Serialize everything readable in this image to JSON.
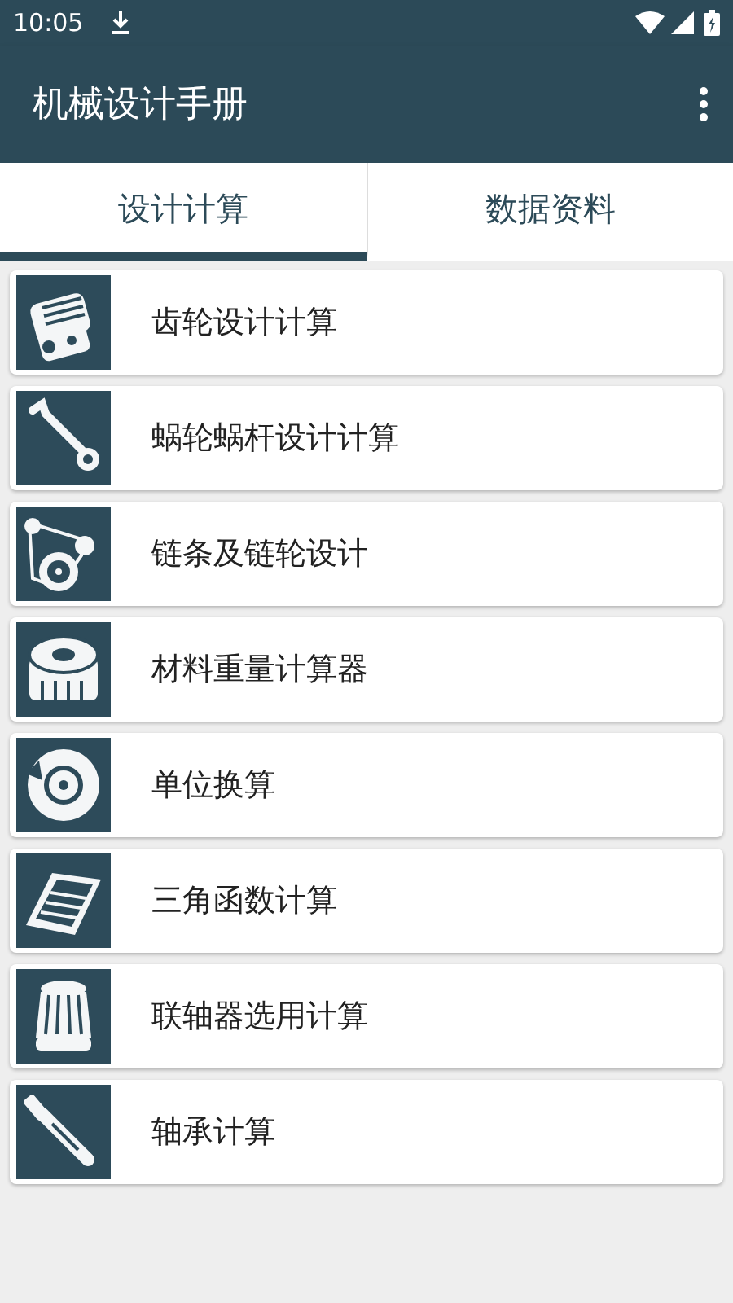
{
  "status_bar": {
    "time": "10:05"
  },
  "app_bar": {
    "title": "机械设计手册"
  },
  "tabs": [
    {
      "label": "设计计算",
      "selected": true
    },
    {
      "label": "数据资料",
      "selected": false
    }
  ],
  "items": [
    {
      "label": "齿轮设计计算"
    },
    {
      "label": "蜗轮蜗杆设计计算"
    },
    {
      "label": "链条及链轮设计"
    },
    {
      "label": "材料重量计算器"
    },
    {
      "label": "单位换算"
    },
    {
      "label": "三角函数计算"
    },
    {
      "label": "联轴器选用计算"
    },
    {
      "label": "轴承计算"
    }
  ]
}
